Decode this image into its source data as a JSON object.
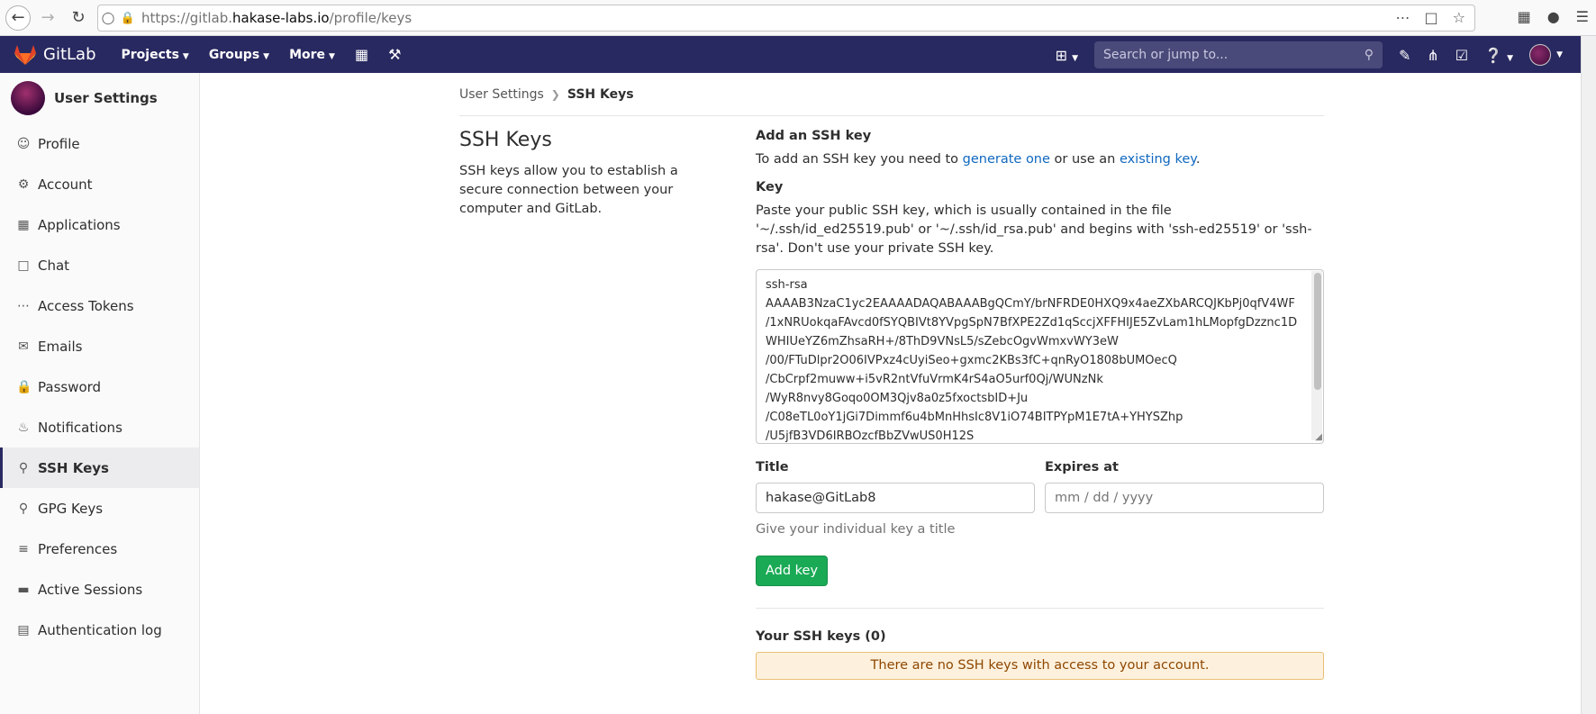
{
  "browser": {
    "url_prefix": "https://gitlab.",
    "url_domain": "hakase-labs.io",
    "url_path": "/profile/keys"
  },
  "header": {
    "brand": "GitLab",
    "nav": [
      "Projects",
      "Groups",
      "More"
    ],
    "search_placeholder": "Search or jump to..."
  },
  "sidebar": {
    "title": "User Settings",
    "items": [
      {
        "label": "Profile",
        "icon": "profile-icon"
      },
      {
        "label": "Account",
        "icon": "account-icon"
      },
      {
        "label": "Applications",
        "icon": "applications-icon"
      },
      {
        "label": "Chat",
        "icon": "chat-icon"
      },
      {
        "label": "Access Tokens",
        "icon": "token-icon"
      },
      {
        "label": "Emails",
        "icon": "mail-icon"
      },
      {
        "label": "Password",
        "icon": "lock-icon"
      },
      {
        "label": "Notifications",
        "icon": "bell-icon"
      },
      {
        "label": "SSH Keys",
        "icon": "key-icon",
        "active": true
      },
      {
        "label": "GPG Keys",
        "icon": "key-icon"
      },
      {
        "label": "Preferences",
        "icon": "preferences-icon"
      },
      {
        "label": "Active Sessions",
        "icon": "monitor-icon"
      },
      {
        "label": "Authentication log",
        "icon": "log-icon"
      }
    ]
  },
  "breadcrumb": {
    "parent": "User Settings",
    "current": "SSH Keys"
  },
  "intro": {
    "title": "SSH Keys",
    "description": "SSH keys allow you to establish a secure connection between your computer and GitLab."
  },
  "form": {
    "heading": "Add an SSH key",
    "instruction_prefix": "To add an SSH key you need to ",
    "generate_link": "generate one",
    "instruction_middle": " or use an ",
    "existing_link": "existing key",
    "instruction_suffix": ".",
    "key_label": "Key",
    "key_help": "Paste your public SSH key, which is usually contained in the file '~/.ssh/id_ed25519.pub' or '~/.ssh/id_rsa.pub' and begins with 'ssh-ed25519' or 'ssh-rsa'. Don't use your private SSH key.",
    "key_value": "ssh-rsa\nAAAAB3NzaC1yc2EAAAADAQABAAABgQCmY/brNFRDE0HXQ9x4aeZXbARCQJKbPj0qfV4WF\n/1xNRUokqaFAvcd0fSYQBIVt8YVpgSpN7BfXPE2Zd1qSccjXFFHIJE5ZvLam1hLMopfgDzznc1D\nWHIUeYZ6mZhsaRH+/8ThD9VNsL5/sZebcOgvWmxvWY3eW\n/00/FTuDlpr2O06IVPxz4cUyiSeo+gxmc2KBs3fC+qnRyO1808bUMOecQ\n/CbCrpf2muww+i5vR2ntVfuVrmK4rS4aO5urf0Qj/WUNzNk\n/WyR8nvy8Goqo0OM3Qjv8a0z5fxoctsbID+Ju\n/C08eTL0oY1jGi7Dimmf6u4bMnHhsIc8V1iO74BITPYpM1E7tA+YHYSZhp\n/U5jfB3VD6IRBOzcfBbZVwUS0H12S",
    "title_label": "Title",
    "title_value": "hakase@GitLab8",
    "title_help": "Give your individual key a title",
    "expires_label": "Expires at",
    "expires_placeholder": "mm / dd / yyyy",
    "submit": "Add key"
  },
  "keys_list": {
    "heading": "Your SSH keys (0)",
    "empty": "There are no SSH keys with access to your account."
  }
}
